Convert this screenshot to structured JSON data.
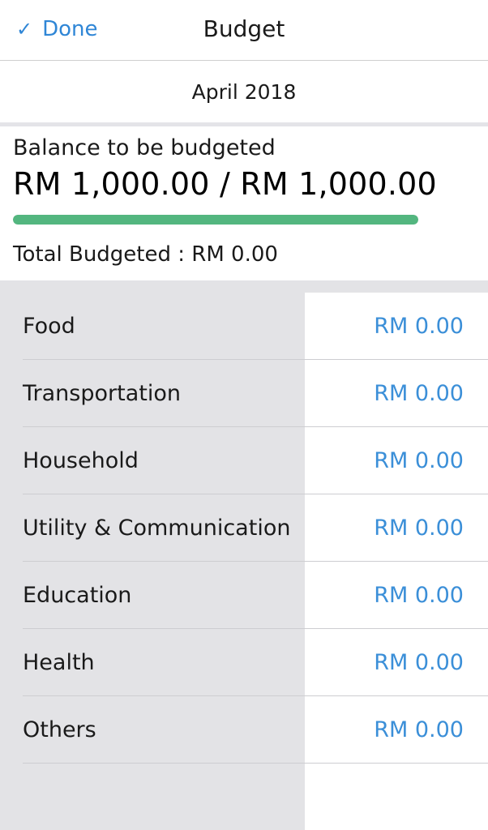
{
  "navbar": {
    "done_check": "✓",
    "done_label": "Done",
    "title": "Budget"
  },
  "month": "April 2018",
  "summary": {
    "balance_label": "Balance to be budgeted",
    "balance_amount": "RM 1,000.00 / RM 1,000.00",
    "progress_fraction": 1.0,
    "progress_color": "#53b67f",
    "total_budgeted": "Total Budgeted : RM 0.00"
  },
  "categories": [
    {
      "label": "Food",
      "amount": "RM 0.00"
    },
    {
      "label": "Transportation",
      "amount": "RM 0.00"
    },
    {
      "label": "Household",
      "amount": "RM 0.00"
    },
    {
      "label": "Utility & Communication",
      "amount": "RM 0.00"
    },
    {
      "label": "Education",
      "amount": "RM 0.00"
    },
    {
      "label": "Health",
      "amount": "RM 0.00"
    },
    {
      "label": "Others",
      "amount": "RM 0.00"
    }
  ],
  "colors": {
    "accent": "#2f86d6",
    "amount_text": "#3b8fd8",
    "list_background": "#e3e3e6"
  }
}
